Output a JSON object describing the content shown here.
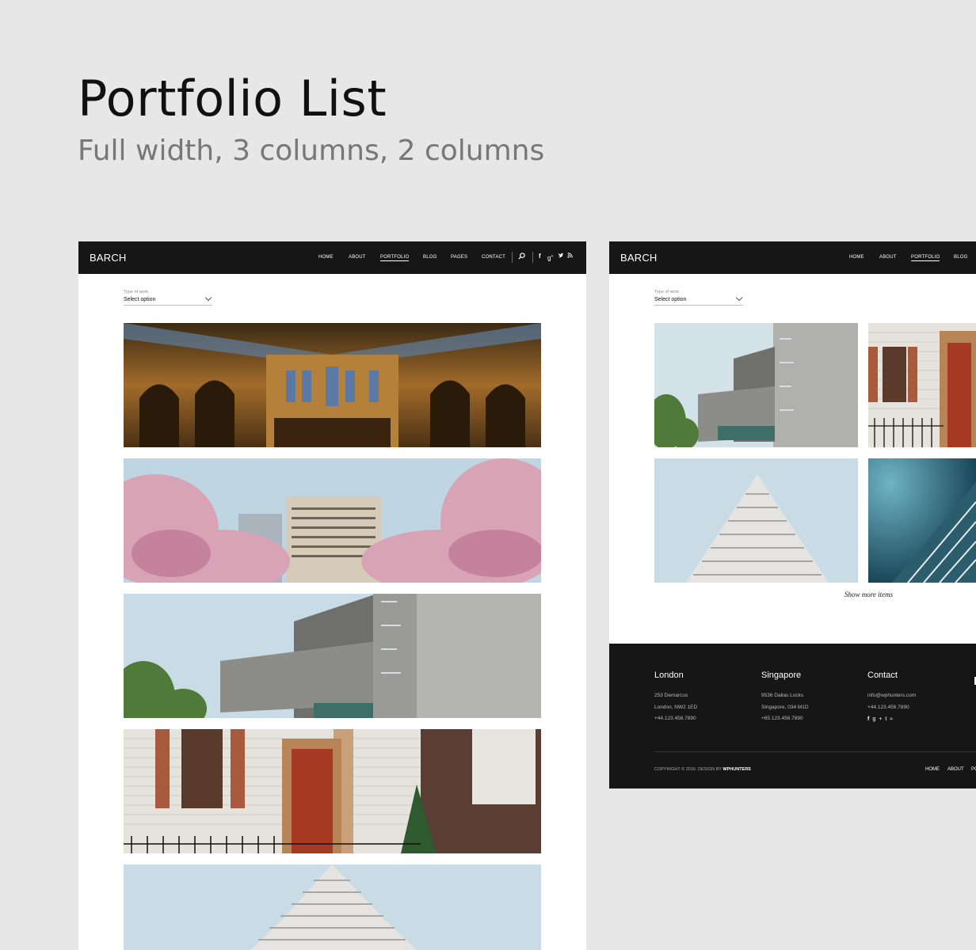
{
  "hero": {
    "title": "Portfolio List",
    "subtitle": "Full width, 3 columns, 2 columns"
  },
  "mockup_left": {
    "logo": "BARCH",
    "nav": [
      "HOME",
      "ABOUT",
      "PORTFOLIO",
      "BLOG",
      "PAGES",
      "CONTACT"
    ],
    "active_nav": "PORTFOLIO",
    "icons": [
      "search-icon",
      "facebook-icon",
      "google-plus-icon",
      "twitter-icon",
      "rss-icon"
    ],
    "filter": {
      "label": "Type of work",
      "value": "Select option"
    }
  },
  "mockup_right": {
    "logo": "BARCH",
    "nav": [
      "HOME",
      "ABOUT",
      "PORTFOLIO",
      "BLOG"
    ],
    "active_nav": "PORTFOLIO",
    "filter": {
      "label": "Type of work",
      "value": "Select option"
    },
    "show_more": "Show more items",
    "footer": {
      "london": {
        "title": "London",
        "lines": [
          "253 Demarcus",
          "London, NW2 1ED",
          "+44.123.456.7890"
        ]
      },
      "singapore": {
        "title": "Singapore",
        "lines": [
          "9536 Dallas Locks",
          "Singapore, 034 M1D",
          "+65.123.456.7890"
        ]
      },
      "contact": {
        "title": "Contact",
        "lines": [
          "info@wphunters.com",
          "+44.123.456.7890"
        ]
      },
      "copyright_prefix": "COPYRIGHT © 2016. DESIGN BY",
      "copyright_brand": "WPHUNTERS",
      "links": [
        "HOME",
        "ABOUT",
        "PO"
      ]
    }
  },
  "colors": {
    "page_background": "#e7e7e7",
    "navbar": "#161616",
    "footer": "#161616",
    "title": "#111111",
    "subtitle": "#777777"
  }
}
